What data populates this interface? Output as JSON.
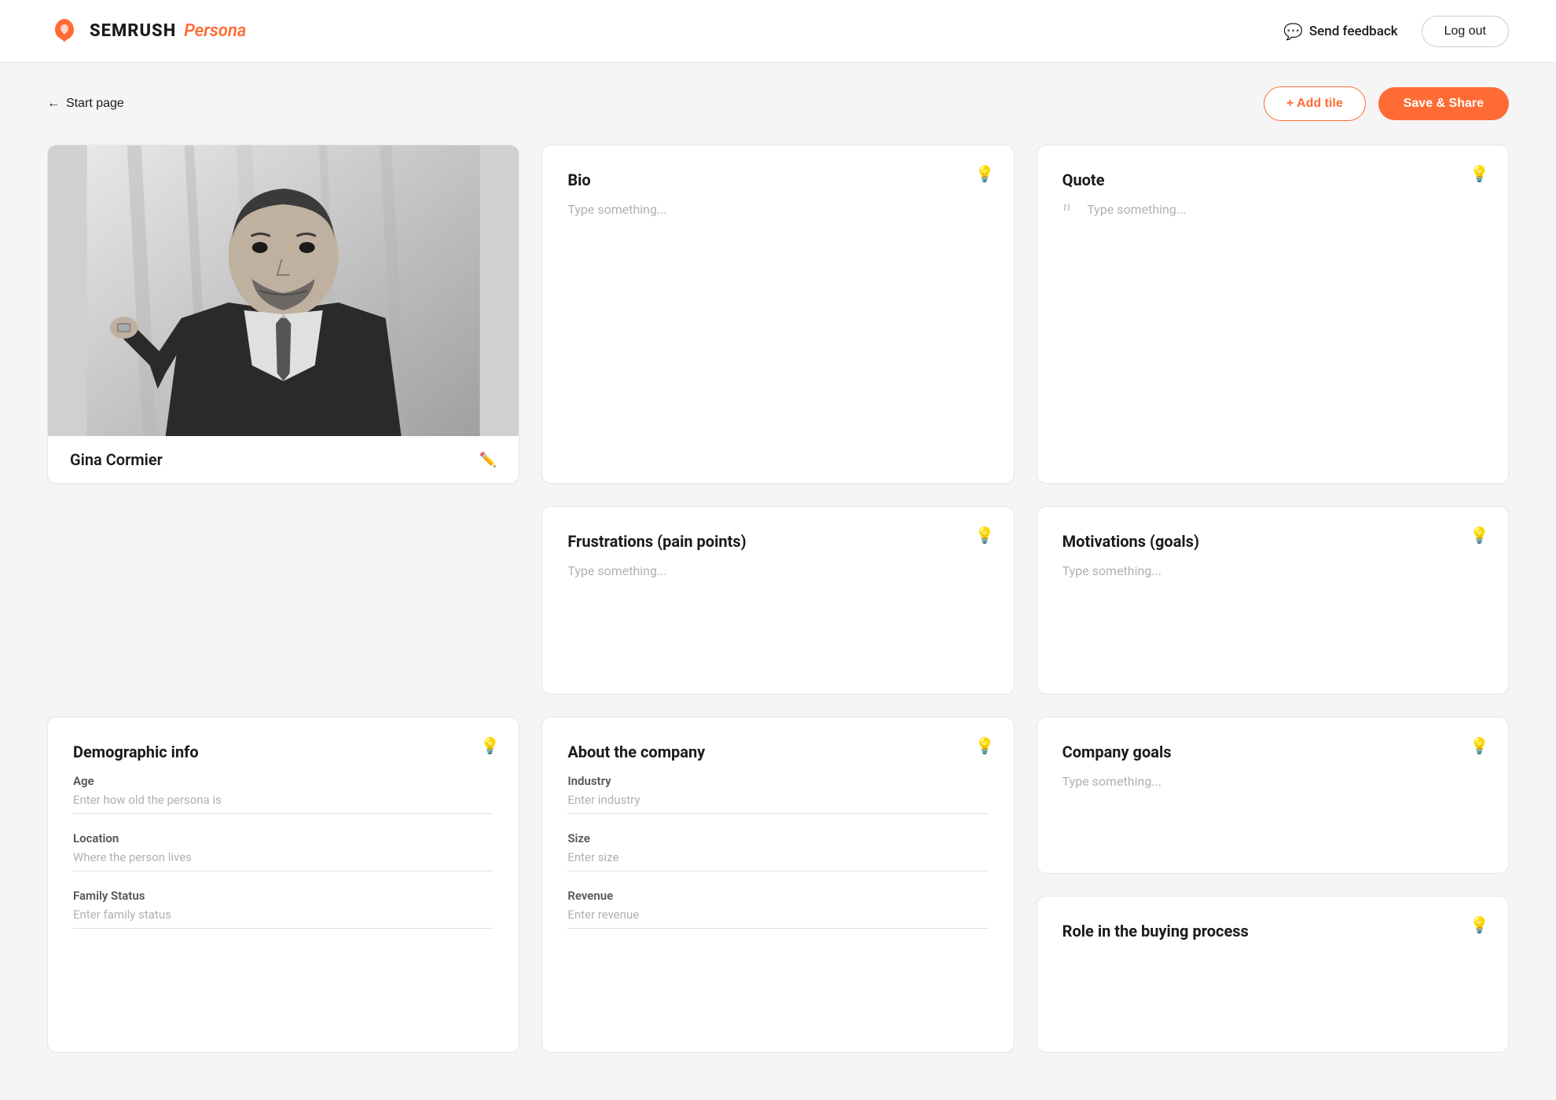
{
  "header": {
    "logo_text": "SEMRUSH",
    "logo_persona": "Persona",
    "send_feedback_label": "Send feedback",
    "logout_label": "Log out"
  },
  "toolbar": {
    "start_page_label": "Start page",
    "add_tile_label": "+ Add tile",
    "save_share_label": "Save & Share"
  },
  "persona": {
    "name": "Gina Cormier"
  },
  "cards": {
    "bio": {
      "title": "Bio",
      "placeholder": "Type something..."
    },
    "quote": {
      "title": "Quote",
      "placeholder": "Type something..."
    },
    "frustrations": {
      "title": "Frustrations (pain points)",
      "placeholder": "Type something..."
    },
    "motivations": {
      "title": "Motivations (goals)",
      "placeholder": "Type something..."
    },
    "demographic": {
      "title": "Demographic info",
      "fields": [
        {
          "label": "Age",
          "placeholder": "Enter how old the persona is"
        },
        {
          "label": "Location",
          "placeholder": "Where the person lives"
        },
        {
          "label": "Family Status",
          "placeholder": "Enter family status"
        }
      ]
    },
    "about_company": {
      "title": "About the company",
      "fields": [
        {
          "label": "Industry",
          "placeholder": "Enter industry"
        },
        {
          "label": "Size",
          "placeholder": "Enter size"
        },
        {
          "label": "Revenue",
          "placeholder": "Enter revenue"
        }
      ]
    },
    "company_goals": {
      "title": "Company goals",
      "placeholder": "Type something..."
    },
    "role_buying": {
      "title": "Role in the buying process"
    }
  }
}
